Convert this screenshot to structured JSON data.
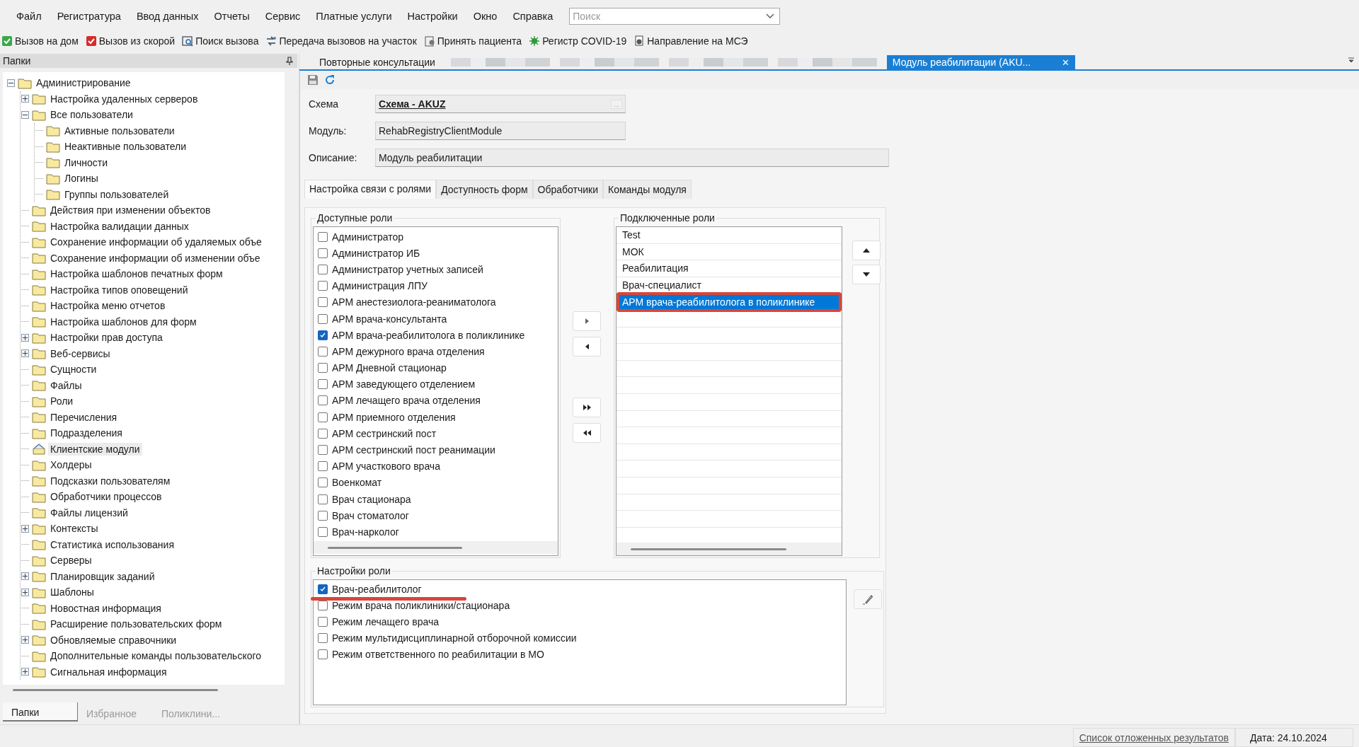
{
  "menu": [
    "Файл",
    "Регистратура",
    "Ввод данных",
    "Отчеты",
    "Сервис",
    "Платные услуги",
    "Настройки",
    "Окно",
    "Справка"
  ],
  "search": {
    "placeholder": "Поиск"
  },
  "toolbar": [
    "Вызов на дом",
    "Вызов из скорой",
    "Поиск вызова",
    "Передача вызовов на участок",
    "Принять пациента",
    "Регистр COVID-19",
    "Направление на МСЭ"
  ],
  "side_panel": {
    "title": "Папки",
    "tree": [
      {
        "label": "Администрирование",
        "expanded": true,
        "selected": false,
        "children": [
          {
            "label": "Настройка удаленных серверов",
            "expanded": false,
            "selected": false
          },
          {
            "label": "Все пользователи",
            "expanded": true,
            "selected": false,
            "children": [
              {
                "label": "Активные пользователи",
                "selected": false
              },
              {
                "label": "Неактивные пользователи",
                "selected": false
              },
              {
                "label": "Личности",
                "selected": false
              },
              {
                "label": "Логины",
                "selected": false
              },
              {
                "label": "Группы пользователей",
                "selected": false
              }
            ]
          },
          {
            "label": "Действия при изменении объектов",
            "selected": false
          },
          {
            "label": "Настройка валидации данных",
            "selected": false
          },
          {
            "label": "Сохранение информации об удаляемых объе",
            "selected": false
          },
          {
            "label": "Сохранение информации об изменении объе",
            "selected": false
          },
          {
            "label": "Настройка шаблонов печатных форм",
            "selected": false
          },
          {
            "label": "Настройка типов оповещений",
            "selected": false
          },
          {
            "label": "Настройка меню отчетов",
            "selected": false
          },
          {
            "label": "Настройка шаблонов для форм",
            "selected": false
          },
          {
            "label": "Настройки прав доступа",
            "expanded": false,
            "selected": false
          },
          {
            "label": "Веб-сервисы",
            "expanded": false,
            "selected": false
          },
          {
            "label": "Сущности",
            "selected": false
          },
          {
            "label": "Файлы",
            "selected": false
          },
          {
            "label": "Роли",
            "selected": false
          },
          {
            "label": "Перечисления",
            "selected": false
          },
          {
            "label": "Подразделения",
            "selected": false
          },
          {
            "label": "Клиентские модули",
            "selected": true
          },
          {
            "label": "Холдеры",
            "selected": false
          },
          {
            "label": "Подсказки пользователям",
            "selected": false
          },
          {
            "label": "Обработчики процессов",
            "selected": false
          },
          {
            "label": "Файлы лицензий",
            "selected": false
          },
          {
            "label": "Контексты",
            "expanded": false,
            "selected": false
          },
          {
            "label": "Статистика использования",
            "selected": false
          },
          {
            "label": "Серверы",
            "selected": false
          },
          {
            "label": "Планировщик заданий",
            "expanded": false,
            "selected": false
          },
          {
            "label": "Шаблоны",
            "expanded": false,
            "selected": false
          },
          {
            "label": "Новостная информация",
            "selected": false
          },
          {
            "label": "Расширение пользовательских форм",
            "selected": false
          },
          {
            "label": "Обновляемые справочники",
            "expanded": false,
            "selected": false
          },
          {
            "label": "Дополнительные команды пользовательского",
            "selected": false
          },
          {
            "label": "Сигнальная информация",
            "expanded": false,
            "selected": false
          }
        ]
      }
    ],
    "tabs": [
      {
        "label": "Папки",
        "selected": true
      },
      {
        "label": "Избранное",
        "selected": false
      },
      {
        "label": "Поликлини...",
        "selected": false
      }
    ]
  },
  "doc_tabs": [
    {
      "kind": "text",
      "label": "Повторные консультации",
      "selected": false
    },
    {
      "kind": "blurred",
      "selected": false
    },
    {
      "kind": "blurred",
      "selected": false
    },
    {
      "kind": "blurred",
      "selected": false
    },
    {
      "kind": "blurred",
      "selected": false
    },
    {
      "kind": "text",
      "label": "Модуль реабилитации (AKU...",
      "selected": true,
      "close": "✕"
    }
  ],
  "form": {
    "fields": [
      {
        "label": "Схема",
        "value": "Схема - AKUZ",
        "kind": "lookup",
        "browse": "..."
      },
      {
        "label": "Модуль:",
        "value": "RehabRegistryClientModule",
        "kind": "short"
      },
      {
        "label": "Описание:",
        "value": "Модуль реабилитации",
        "kind": "long"
      }
    ],
    "tabs": [
      {
        "label": "Настройка связи с ролями",
        "selected": true
      },
      {
        "label": "Доступность форм",
        "selected": false
      },
      {
        "label": "Обработчики",
        "selected": false
      },
      {
        "label": "Команды модуля",
        "selected": false
      }
    ],
    "available_roles": {
      "title": "Доступные роли",
      "items": [
        {
          "label": "Администратор",
          "checked": false
        },
        {
          "label": "Администратор ИБ",
          "checked": false
        },
        {
          "label": "Администратор учетных записей",
          "checked": false
        },
        {
          "label": "Администрация ЛПУ",
          "checked": false
        },
        {
          "label": "АРМ анестезиолога-реаниматолога",
          "checked": false
        },
        {
          "label": "АРМ врача-консультанта",
          "checked": false
        },
        {
          "label": "АРМ врача-реабилитолога в поликлинике",
          "checked": true
        },
        {
          "label": "АРМ дежурного врача отделения",
          "checked": false
        },
        {
          "label": "АРМ Дневной стационар",
          "checked": false
        },
        {
          "label": "АРМ заведующего отделением",
          "checked": false
        },
        {
          "label": "АРМ лечащего врача отделения",
          "checked": false
        },
        {
          "label": "АРМ приемного отделения",
          "checked": false
        },
        {
          "label": "АРМ сестринский пост",
          "checked": false
        },
        {
          "label": "АРМ сестринский пост реанимации",
          "checked": false
        },
        {
          "label": "АРМ участкового врача",
          "checked": false
        },
        {
          "label": "Военкомат",
          "checked": false
        },
        {
          "label": "Врач стационара",
          "checked": false
        },
        {
          "label": "Врач стоматолог",
          "checked": false
        },
        {
          "label": "Врач-нарколог",
          "checked": false
        }
      ]
    },
    "connected_roles": {
      "title": "Подключенные роли",
      "items": [
        {
          "label": "Test",
          "selected": false,
          "marked": false
        },
        {
          "label": "МОК",
          "selected": false,
          "marked": false
        },
        {
          "label": "Реабилитация",
          "selected": false,
          "marked": false
        },
        {
          "label": "Врач-специалист",
          "selected": false,
          "marked": false
        },
        {
          "label": "АРМ врача-реабилитолога в поликлинике",
          "selected": true,
          "marked": true
        }
      ]
    },
    "role_settings": {
      "title": "Настройки роли",
      "items": [
        {
          "label": "Врач-реабилитолог",
          "checked": true,
          "marked": true
        },
        {
          "label": "Режим врача поликлиники/стационара",
          "checked": false,
          "marked": false
        },
        {
          "label": "Режим лечащего врача",
          "checked": false,
          "marked": false
        },
        {
          "label": "Режим мультидисциплинарной отборочной комиссии",
          "checked": false,
          "marked": false
        },
        {
          "label": "Режим ответственного по реабилитации в МО",
          "checked": false,
          "marked": false
        }
      ]
    }
  },
  "status_bar": {
    "link": "Список отложенных результатов",
    "date": "Дата: 24.10.2024"
  }
}
